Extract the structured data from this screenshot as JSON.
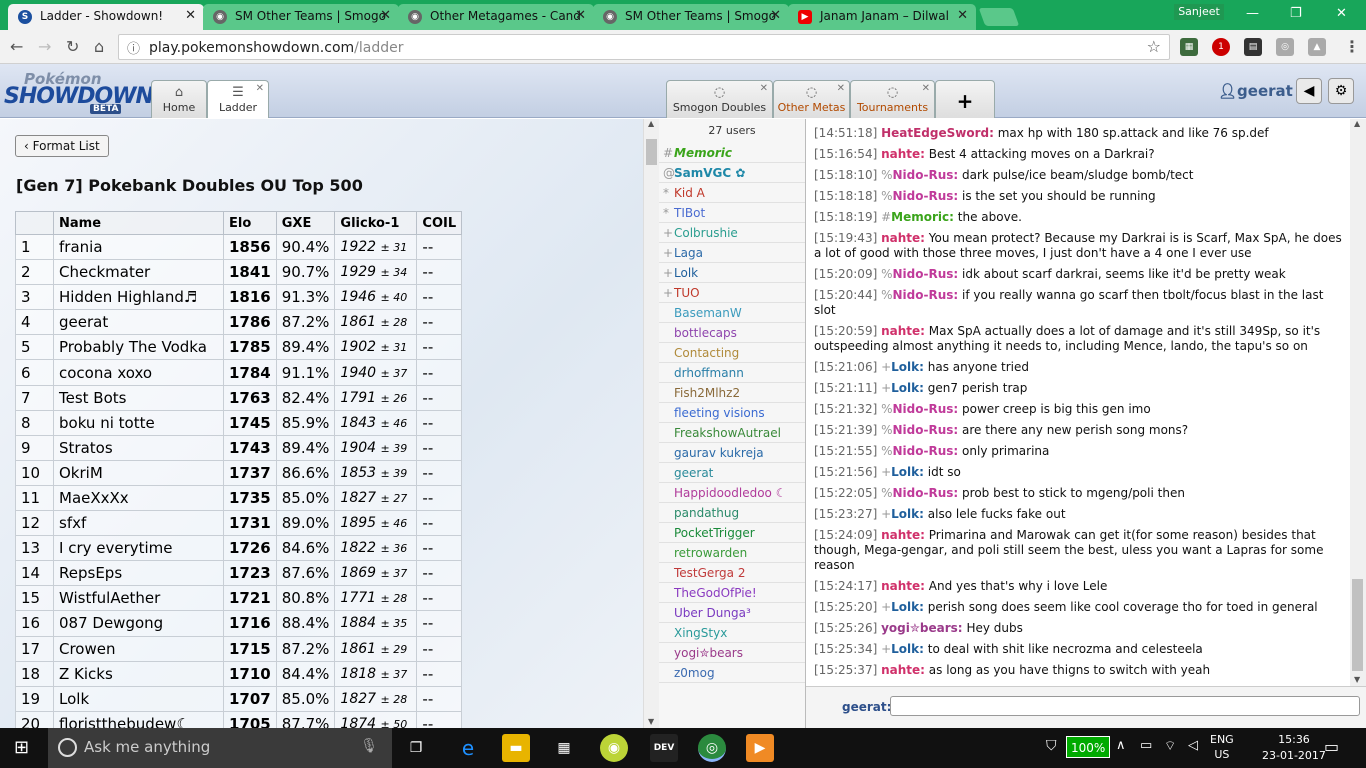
{
  "browser": {
    "tabs": [
      {
        "title": "Ladder - Showdown!",
        "active": true,
        "icon": "showdown-icon"
      },
      {
        "title": "SM Other Teams | Smogo",
        "active": false,
        "icon": "smogon-icon"
      },
      {
        "title": "Other Metagames - Cand",
        "active": false,
        "icon": "smogon-icon"
      },
      {
        "title": "SM Other Teams | Smogo",
        "active": false,
        "icon": "smogon-icon"
      },
      {
        "title": "Janam Janam – Dilwal",
        "active": false,
        "icon": "youtube-icon"
      }
    ],
    "window_user": "Sanjeet",
    "url": "play.pokemonshowdown.com/ladder",
    "url_host": "play.pokemonshowdown.com",
    "url_path": "/ladder",
    "abp_count": "1"
  },
  "logo": {
    "line1": "Pokémon",
    "line2": "SHOWDOWN",
    "badge": "BETA"
  },
  "ps_tabs": {
    "home": "Home",
    "ladder": "Ladder",
    "rooms": [
      {
        "label": "Smogon Doubles"
      },
      {
        "label": "Other Metas"
      },
      {
        "label": "Tournaments"
      }
    ],
    "add": "+"
  },
  "user": {
    "name": "geerat"
  },
  "ladder": {
    "format_button": "Format List",
    "title": "[Gen 7] Pokebank Doubles OU Top 500",
    "columns": [
      "",
      "Name",
      "Elo",
      "GXE",
      "Glicko-1",
      "COIL"
    ],
    "rows": [
      [
        "1",
        "frania",
        "1856",
        "90.4%",
        "1922",
        "± 31",
        "--"
      ],
      [
        "2",
        "Checkmater",
        "1841",
        "90.7%",
        "1929",
        "± 34",
        "--"
      ],
      [
        "3",
        "Hidden Highland♬",
        "1816",
        "91.3%",
        "1946",
        "± 40",
        "--"
      ],
      [
        "4",
        "geerat",
        "1786",
        "87.2%",
        "1861",
        "± 28",
        "--"
      ],
      [
        "5",
        "Probably The Vodka",
        "1785",
        "89.4%",
        "1902",
        "± 31",
        "--"
      ],
      [
        "6",
        "cocona xoxo",
        "1784",
        "91.1%",
        "1940",
        "± 37",
        "--"
      ],
      [
        "7",
        "Test Bots",
        "1763",
        "82.4%",
        "1791",
        "± 26",
        "--"
      ],
      [
        "8",
        "boku ni totte",
        "1745",
        "85.9%",
        "1843",
        "± 46",
        "--"
      ],
      [
        "9",
        "Stratos",
        "1743",
        "89.4%",
        "1904",
        "± 39",
        "--"
      ],
      [
        "10",
        "OkriM",
        "1737",
        "86.6%",
        "1853",
        "± 39",
        "--"
      ],
      [
        "11",
        "MaeXxXx",
        "1735",
        "85.0%",
        "1827",
        "± 27",
        "--"
      ],
      [
        "12",
        "sfxf",
        "1731",
        "89.0%",
        "1895",
        "± 46",
        "--"
      ],
      [
        "13",
        "I cry everytime",
        "1726",
        "84.6%",
        "1822",
        "± 36",
        "--"
      ],
      [
        "14",
        "RepsEps",
        "1723",
        "87.6%",
        "1869",
        "± 37",
        "--"
      ],
      [
        "15",
        "WistfulAether",
        "1721",
        "80.8%",
        "1771",
        "± 28",
        "--"
      ],
      [
        "16",
        "087 Dewgong",
        "1716",
        "88.4%",
        "1884",
        "± 35",
        "--"
      ],
      [
        "17",
        "Crowen",
        "1715",
        "87.2%",
        "1861",
        "± 29",
        "--"
      ],
      [
        "18",
        "Z Kicks",
        "1710",
        "84.4%",
        "1818",
        "± 37",
        "--"
      ],
      [
        "19",
        "Lolk",
        "1707",
        "85.0%",
        "1827",
        "± 28",
        "--"
      ],
      [
        "20",
        "floristthebudew☾",
        "1705",
        "87.7%",
        "1874",
        "± 50",
        "--"
      ]
    ]
  },
  "userlist": {
    "count": "27 users",
    "users": [
      {
        "group": "#",
        "name": "Memoric",
        "color": "#3aa41a",
        "style": "bolditalic"
      },
      {
        "group": "@",
        "name": "SamVGC ✿",
        "color": "#1e88a8",
        "style": "bold"
      },
      {
        "group": "*",
        "name": "Kid A",
        "color": "#c0392b",
        "style": ""
      },
      {
        "group": "*",
        "name": "TIBot",
        "color": "#4b6cd1",
        "style": ""
      },
      {
        "group": "+",
        "name": "Colbrushie",
        "color": "#2a9d8f",
        "style": ""
      },
      {
        "group": "+",
        "name": "Laga",
        "color": "#2c6aa8",
        "style": ""
      },
      {
        "group": "+",
        "name": "Lolk",
        "color": "#1f5f9c",
        "style": ""
      },
      {
        "group": "+",
        "name": "TUO",
        "color": "#c0392b",
        "style": ""
      },
      {
        "group": "",
        "name": "BasemanW",
        "color": "#3b9bbd",
        "style": ""
      },
      {
        "group": "",
        "name": "bottlecaps",
        "color": "#8e44ad",
        "style": ""
      },
      {
        "group": "",
        "name": "Contacting",
        "color": "#b08a3a",
        "style": ""
      },
      {
        "group": "",
        "name": "drhoffmann",
        "color": "#2a7fa8",
        "style": ""
      },
      {
        "group": "",
        "name": "Fish2Mlhz2",
        "color": "#8a6a3a",
        "style": ""
      },
      {
        "group": "",
        "name": "fleeting visions",
        "color": "#3a6ad1",
        "style": ""
      },
      {
        "group": "",
        "name": "FreakshowAutrael",
        "color": "#3a8a3a",
        "style": ""
      },
      {
        "group": "",
        "name": "gaurav kukreja",
        "color": "#2a6aa8",
        "style": ""
      },
      {
        "group": "",
        "name": "geerat",
        "color": "#2a8a9a",
        "style": ""
      },
      {
        "group": "",
        "name": "Happidoodledoo ☾",
        "color": "#b03a9a",
        "style": ""
      },
      {
        "group": "",
        "name": "pandathug",
        "color": "#2a8a6a",
        "style": ""
      },
      {
        "group": "",
        "name": "PocketTrigger",
        "color": "#1a8a3a",
        "style": ""
      },
      {
        "group": "",
        "name": "retrowarden",
        "color": "#3a9a3a",
        "style": ""
      },
      {
        "group": "",
        "name": "TestGerga 2",
        "color": "#c03a3a",
        "style": ""
      },
      {
        "group": "",
        "name": "TheGodOfPie!",
        "color": "#8a3ac0",
        "style": ""
      },
      {
        "group": "",
        "name": "Uber Dunga³",
        "color": "#7a3ac0",
        "style": ""
      },
      {
        "group": "",
        "name": "XingStyx",
        "color": "#2a9a9a",
        "style": ""
      },
      {
        "group": "",
        "name": "yogi✮bears",
        "color": "#9a3a8a",
        "style": ""
      },
      {
        "group": "",
        "name": "z0mog",
        "color": "#3a6ab0",
        "style": ""
      }
    ]
  },
  "chat": {
    "messages": [
      {
        "ts": "[14:51:18]",
        "group": "",
        "user": "HeatEdgeSword:",
        "color": "#c0306a",
        "text": "max hp with 180 sp.attack and like 76 sp.def"
      },
      {
        "ts": "[15:16:54]",
        "group": "",
        "user": "nahte:",
        "color": "#d0306a",
        "text": "Best 4 attacking moves on a Darkrai?"
      },
      {
        "ts": "[15:18:10]",
        "group": "%",
        "user": "Nido-Rus:",
        "color": "#c03a9a",
        "text": "dark pulse/ice beam/sludge bomb/tect"
      },
      {
        "ts": "[15:18:18]",
        "group": "%",
        "user": "Nido-Rus:",
        "color": "#c03a9a",
        "text": "is the set you should be running"
      },
      {
        "ts": "[15:18:19]",
        "group": "#",
        "user": "Memoric:",
        "color": "#3aa41a",
        "text": "the above."
      },
      {
        "ts": "[15:19:43]",
        "group": "",
        "user": "nahte:",
        "color": "#d0306a",
        "text": "You mean protect? Because my Darkrai is is Scarf, Max SpA, he does a lot of good with those three moves, I just don't have a 4 one I ever use"
      },
      {
        "ts": "[15:20:09]",
        "group": "%",
        "user": "Nido-Rus:",
        "color": "#c03a9a",
        "text": "idk about scarf darkrai, seems like it'd be pretty weak"
      },
      {
        "ts": "[15:20:44]",
        "group": "%",
        "user": "Nido-Rus:",
        "color": "#c03a9a",
        "text": "if you really wanna go scarf then tbolt/focus blast in the last slot"
      },
      {
        "ts": "[15:20:59]",
        "group": "",
        "user": "nahte:",
        "color": "#d0306a",
        "text": "Max SpA actually does a lot of damage and it's still 349Sp, so it's outspeeding almost anything it needs to, including Mence, lando, the tapu's so on"
      },
      {
        "ts": "[15:21:06]",
        "group": "+",
        "user": "Lolk:",
        "color": "#1f5f9c",
        "text": "has anyone tried"
      },
      {
        "ts": "[15:21:11]",
        "group": "+",
        "user": "Lolk:",
        "color": "#1f5f9c",
        "text": "gen7 perish trap"
      },
      {
        "ts": "[15:21:32]",
        "group": "%",
        "user": "Nido-Rus:",
        "color": "#c03a9a",
        "text": "power creep is big this gen imo"
      },
      {
        "ts": "[15:21:39]",
        "group": "%",
        "user": "Nido-Rus:",
        "color": "#c03a9a",
        "text": "are there any new perish song mons?"
      },
      {
        "ts": "[15:21:55]",
        "group": "%",
        "user": "Nido-Rus:",
        "color": "#c03a9a",
        "text": "only primarina"
      },
      {
        "ts": "[15:21:56]",
        "group": "+",
        "user": "Lolk:",
        "color": "#1f5f9c",
        "text": "idt so"
      },
      {
        "ts": "[15:22:05]",
        "group": "%",
        "user": "Nido-Rus:",
        "color": "#c03a9a",
        "text": "prob best to stick to mgeng/poli then"
      },
      {
        "ts": "[15:23:27]",
        "group": "+",
        "user": "Lolk:",
        "color": "#1f5f9c",
        "text": "also lele fucks fake out"
      },
      {
        "ts": "[15:24:09]",
        "group": "",
        "user": "nahte:",
        "color": "#d0306a",
        "text": "Primarina and Marowak can get it(for some reason) besides that though, Mega-gengar, and poli still seem the best, uless you want a Lapras for some reason"
      },
      {
        "ts": "[15:24:17]",
        "group": "",
        "user": "nahte:",
        "color": "#d0306a",
        "text": "And yes that's why i love Lele"
      },
      {
        "ts": "[15:25:20]",
        "group": "+",
        "user": "Lolk:",
        "color": "#1f5f9c",
        "text": "perish song does seem like cool coverage tho for toed in general"
      },
      {
        "ts": "[15:25:26]",
        "group": "",
        "user": "yogi✮bears:",
        "color": "#9a3a8a",
        "text": "Hey dubs"
      },
      {
        "ts": "[15:25:34]",
        "group": "+",
        "user": "Lolk:",
        "color": "#1f5f9c",
        "text": "to deal with shit like necrozma and celesteela"
      },
      {
        "ts": "[15:25:37]",
        "group": "",
        "user": "nahte:",
        "color": "#d0306a",
        "text": "as long as you have thigns to switch with yeah"
      }
    ],
    "input_label": "geerat:"
  },
  "taskbar": {
    "search_placeholder": "Ask me anything",
    "battery": "100%",
    "lang1": "ENG",
    "lang2": "US",
    "time": "15:36",
    "date": "23-01-2017"
  }
}
